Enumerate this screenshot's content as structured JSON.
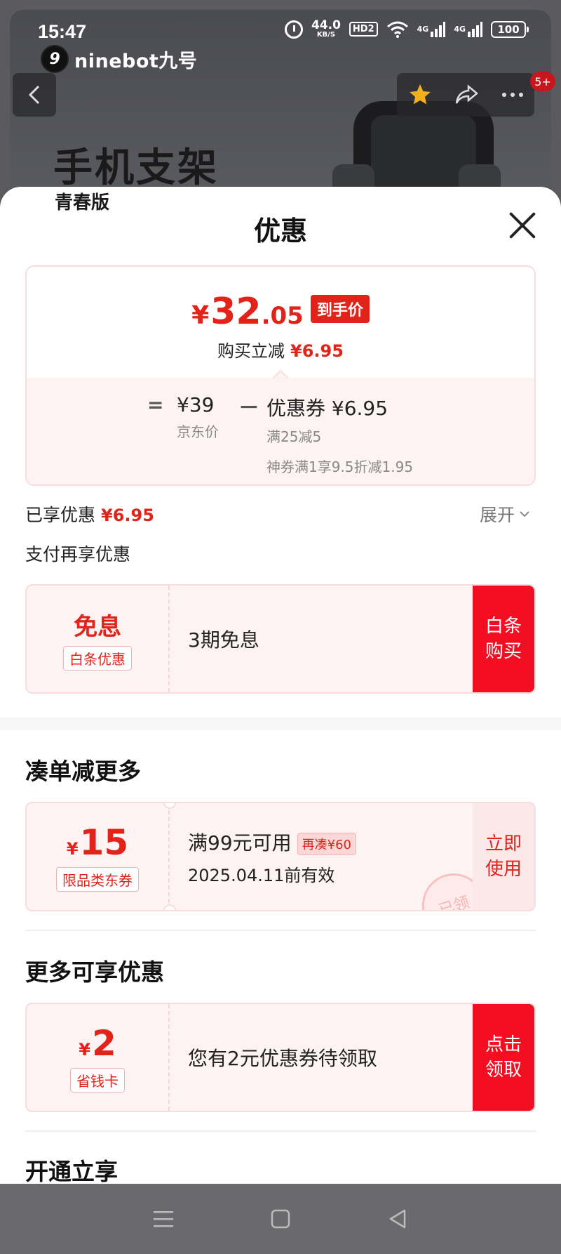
{
  "status_bar": {
    "time": "15:47",
    "net_speed": "44.0",
    "net_unit": "KB/S",
    "hd": "HD2",
    "sig1": "4G",
    "sig2": "4G",
    "battery": "100"
  },
  "product_page": {
    "brand": "ninebot九号",
    "brand_mark": "9",
    "hero_title": "手机支架",
    "hero_sub": "青春版",
    "cart_badge": "5+"
  },
  "sheet": {
    "title": "优惠",
    "price": {
      "yen": "¥",
      "int": "32",
      "dec": ".05",
      "tag": "到手价",
      "instant_label": "购买立减",
      "instant_value": "¥6.95"
    },
    "calc": {
      "eq": "=",
      "jd_value": "¥39",
      "jd_label": "京东价",
      "minus": "－",
      "coupon_value": "优惠券 ¥6.95",
      "coupon_line1": "满25减5",
      "coupon_line2": "神券满1享9.5折减1.95"
    },
    "enjoyed_label": "已享优惠",
    "enjoyed_value": "¥6.95",
    "expand_label": "展开",
    "pay_more_label": "支付再享优惠",
    "baitiao": {
      "left_title": "免息",
      "left_tag": "白条优惠",
      "main": "3期免息",
      "cta_l1": "白条",
      "cta_l2": "购买"
    },
    "section_more_order": "凑单减更多",
    "coupon15": {
      "yen": "¥",
      "amount": "15",
      "tag": "限品类东券",
      "main": "满99元可用",
      "pill": "再凑¥60",
      "sub": "2025.04.11前有效",
      "stamp": "已领",
      "cta_l1": "立即",
      "cta_l2": "使用"
    },
    "section_more_benefits": "更多可享优惠",
    "coupon2": {
      "yen": "¥",
      "amount": "2",
      "tag": "省钱卡",
      "main": "您有2元优惠券待领取",
      "cta_l1": "点击",
      "cta_l2": "领取"
    },
    "section_open": "开通立享"
  },
  "colors": {
    "accent_red": "#e2231a",
    "cta_red": "#f40e22",
    "card_pink": "#fdf3f3"
  }
}
